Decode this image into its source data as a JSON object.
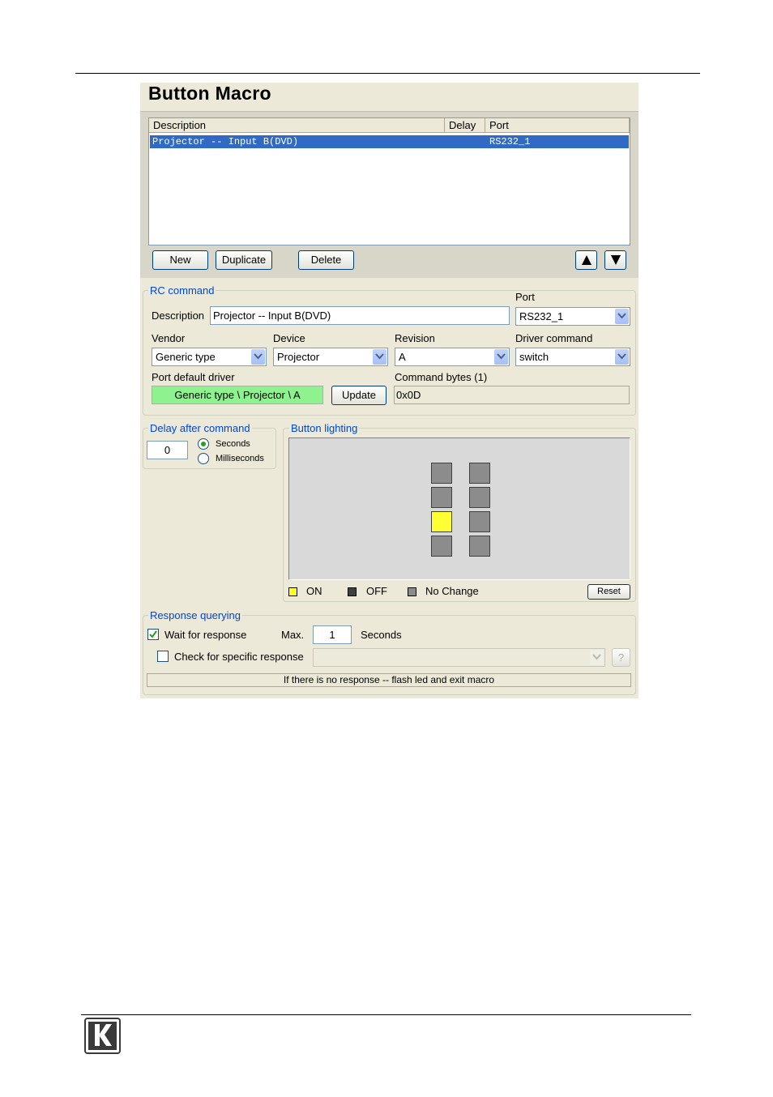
{
  "title": "Button Macro",
  "macro_list": {
    "columns": [
      "Description",
      "Delay",
      "Port"
    ],
    "rows": [
      {
        "description": "Projector -- Input B(DVD)",
        "delay": "",
        "port": "RS232_1"
      }
    ]
  },
  "buttons": {
    "new": "New",
    "duplicate": "Duplicate",
    "delete": "Delete",
    "update": "Update",
    "reset": "Reset"
  },
  "rc_command": {
    "legend": "RC command",
    "description_label": "Description",
    "description_value": "Projector -- Input B(DVD)",
    "port_label": "Port",
    "port_value": "RS232_1",
    "vendor_label": "Vendor",
    "vendor_value": "Generic type",
    "device_label": "Device",
    "device_value": "Projector",
    "revision_label": "Revision",
    "revision_value": "A",
    "driver_command_label": "Driver command",
    "driver_command_value": "switch",
    "port_default_driver_label": "Port default driver",
    "port_default_driver_value": "Generic type \\ Projector \\ A",
    "command_bytes_label": "Command bytes (1)",
    "command_bytes_value": "0x0D"
  },
  "delay": {
    "legend": "Delay after command",
    "value": "0",
    "seconds_label": "Seconds",
    "milliseconds_label": "Milliseconds",
    "selected": "seconds"
  },
  "lighting": {
    "legend": "Button lighting",
    "grid": [
      [
        "nochange",
        "nochange"
      ],
      [
        "nochange",
        "nochange"
      ],
      [
        "on",
        "nochange"
      ],
      [
        "nochange",
        "nochange"
      ]
    ],
    "legend_on": "ON",
    "legend_off": "OFF",
    "legend_nochange": "No Change",
    "colors": {
      "on": "#ffff33",
      "off": "#404040",
      "nochange": "#8c8c8c"
    }
  },
  "response": {
    "legend": "Response querying",
    "wait_label": "Wait for response",
    "wait_checked": true,
    "max_label": "Max.",
    "max_value": "1",
    "seconds_label": "Seconds",
    "specific_label": "Check for specific response",
    "specific_checked": false,
    "help_label": "?",
    "status": "If there is no response -- flash led and exit macro"
  }
}
